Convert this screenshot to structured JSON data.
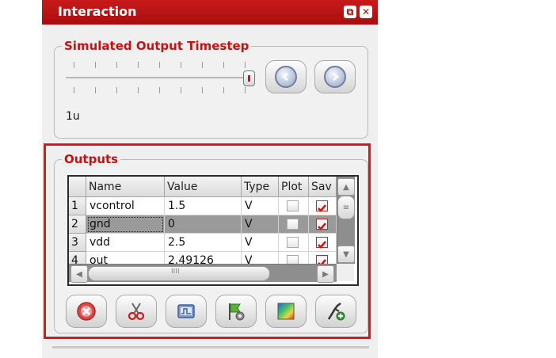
{
  "window": {
    "title": "Interaction"
  },
  "timestep": {
    "group_title": "Simulated Output Timestep",
    "value_label": "1u"
  },
  "outputs": {
    "group_title": "Outputs",
    "columns": [
      "Name",
      "Value",
      "Type",
      "Plot",
      "Sav"
    ],
    "rows": [
      {
        "num": "1",
        "name": "vcontrol",
        "value": "1.5",
        "type": "V",
        "plot": false,
        "save": true
      },
      {
        "num": "2",
        "name": "gnd",
        "value": "0",
        "type": "V",
        "plot": false,
        "save": true
      },
      {
        "num": "3",
        "name": "vdd",
        "value": "2.5",
        "type": "V",
        "plot": false,
        "save": true
      },
      {
        "num": "4",
        "name": "out",
        "value": "2.49126",
        "type": "V",
        "plot": false,
        "save": true
      }
    ],
    "scroll_grip": "IIII"
  },
  "icons": {
    "restore": "restore-icon",
    "close": "close-icon",
    "prev": "arrow-left-icon",
    "next": "arrow-right-icon",
    "delete": "delete-icon",
    "cut": "scissors-icon",
    "waveform": "waveform-icon",
    "settings": "flag-settings-icon",
    "image": "image-icon",
    "probe": "probe-add-icon"
  },
  "colors": {
    "accent": "#c81212",
    "highlight_box": "#e01515",
    "selected_row": "#9a9a9a"
  }
}
